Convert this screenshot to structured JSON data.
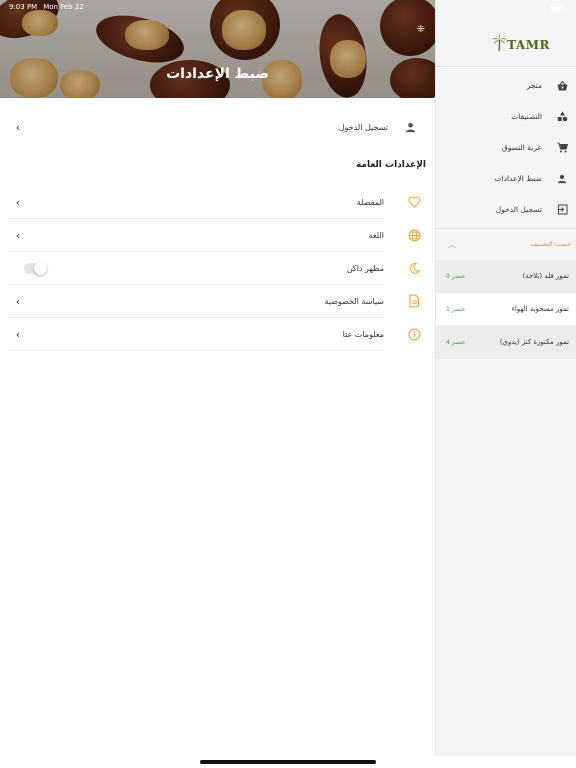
{
  "status_bar": {
    "time": "9:03 PM",
    "date": "Mon Feb 22"
  },
  "header": {
    "title": "ضبط الإعدادات"
  },
  "login_row": {
    "label": "تسجيل الدخول"
  },
  "general_settings": {
    "title": "الإعدادات العامة",
    "items": [
      {
        "label": "المفضلة",
        "icon": "heart-icon"
      },
      {
        "label": "اللغة",
        "icon": "globe-icon"
      },
      {
        "label": "مظهر داكن",
        "icon": "moon-icon",
        "toggle": false
      },
      {
        "label": "سياسة الخصوصية",
        "icon": "document-icon"
      },
      {
        "label": "معلومات عنا",
        "icon": "info-icon"
      }
    ]
  },
  "sidebar": {
    "logo_text": "TAMR",
    "items": [
      {
        "label": "متجر",
        "icon": "basket-icon"
      },
      {
        "label": "التصنيفات",
        "icon": "categories-icon"
      },
      {
        "label": "عربة التسوق",
        "icon": "cart-icon"
      },
      {
        "label": "ضبط الإعدادات",
        "icon": "person-icon"
      },
      {
        "label": "تسجيل الدخول",
        "icon": "login-icon"
      }
    ],
    "categories_header": "حسب التصنيف",
    "categories": [
      {
        "name": "تمور فله (ثلاجة)",
        "count": "0 عنصر"
      },
      {
        "name": "تمور مسحوبة الهواء",
        "count": "1 عنصر"
      },
      {
        "name": "تمور مكنوزة كنز (يدوي)",
        "count": "4 عنصر"
      }
    ]
  },
  "colors": {
    "accent": "#F0A23A",
    "count_green": "#3AA24A",
    "logo_green": "#4A6B1F"
  }
}
